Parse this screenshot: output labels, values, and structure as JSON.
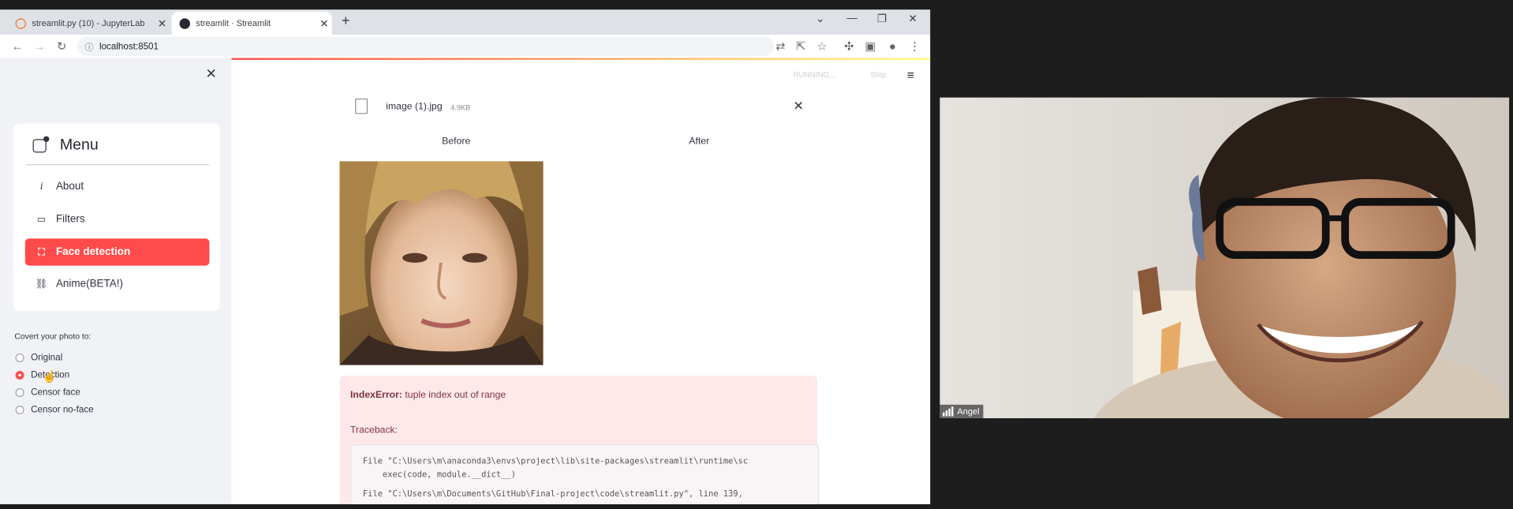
{
  "browser": {
    "tabs": [
      {
        "title": "streamlit.py (10) - JupyterLab",
        "favicon": "jupyter-icon",
        "color": "#f37626"
      },
      {
        "title": "streamlit · Streamlit",
        "favicon": "streamlit-icon",
        "color": "#262730"
      }
    ],
    "url": "localhost:8501",
    "window_controls": [
      "chevron-down-icon",
      "minimize-icon",
      "restore-icon",
      "close-icon"
    ]
  },
  "sidebar": {
    "menu_title": "Menu",
    "menu_items": [
      {
        "label": "About",
        "icon": "info-icon"
      },
      {
        "label": "Filters",
        "icon": "image-icon"
      },
      {
        "label": "Face detection",
        "icon": "face-icon",
        "active": true
      },
      {
        "label": "Anime(BETA!)",
        "icon": "link-icon"
      }
    ],
    "radio_title": "Covert your photo to:",
    "radio_options": [
      "Original",
      "Detection",
      "Censor face",
      "Censor no-face"
    ],
    "selected_option": "Detection",
    "accent": "#ff4b4b"
  },
  "main": {
    "status": "RUNNING...",
    "stop_label": "Stop",
    "file": {
      "name": "image (1).jpg",
      "size": "4.9KB"
    },
    "columns": [
      "Before",
      "After"
    ],
    "error": {
      "type": "IndexError:",
      "message": "tuple index out of range",
      "traceback_label": "Traceback:",
      "lines": [
        "File \"C:\\Users\\m\\anaconda3\\envs\\project\\lib\\site-packages\\streamlit\\runtime\\sc",
        "    exec(code, module.__dict__)",
        "File \"C:\\Users\\m\\Documents\\GitHub\\Final-project\\code\\streamlit.py\", line 139,"
      ]
    }
  },
  "video": {
    "participant": "Angel"
  }
}
